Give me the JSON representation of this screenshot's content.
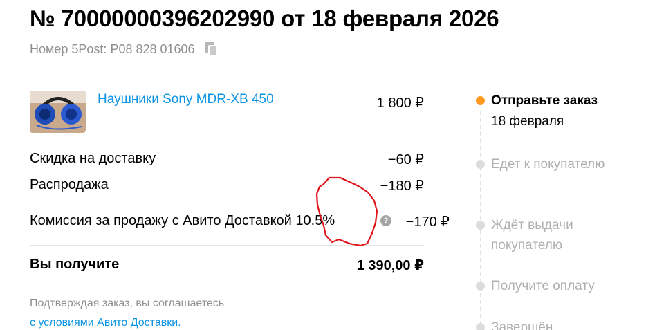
{
  "order": {
    "title": "№ 70000000396202990 от 18 февраля 2026",
    "tracking_label": "Номер 5Post: P08 828 01606"
  },
  "product": {
    "name": "Наушники Sony MDR-XB 450",
    "price": "1 800 ₽"
  },
  "lines": [
    {
      "label": "Скидка на доставку",
      "value": "−60 ₽"
    },
    {
      "label": "Распродажа",
      "value": "−180 ₽"
    },
    {
      "label": "Комиссия за продажу с Авито Доставкой 10.5%",
      "value": "−170 ₽"
    }
  ],
  "total": {
    "label": "Вы получите",
    "value": "1 390,00 ₽"
  },
  "agreement": {
    "text": "Подтверждая заказ, вы соглашаетесь",
    "link": "с условиями Авито Доставки."
  },
  "timeline": [
    {
      "title": "Отправьте заказ",
      "subtitle": "18 февраля",
      "active": true
    },
    {
      "title": "Едет к покупателю",
      "active": false
    },
    {
      "title": "Ждёт выдачи покупателю",
      "active": false
    },
    {
      "title": "Получите оплату",
      "active": false
    },
    {
      "title": "Завершён",
      "active": false
    }
  ],
  "colors": {
    "link": "#0a94e3",
    "active_step": "#ff9a1f",
    "muted": "#8f8f8f",
    "annotation": "#e0141b"
  },
  "icons": {
    "copy": "copy-icon",
    "help": "question-circle-icon"
  }
}
